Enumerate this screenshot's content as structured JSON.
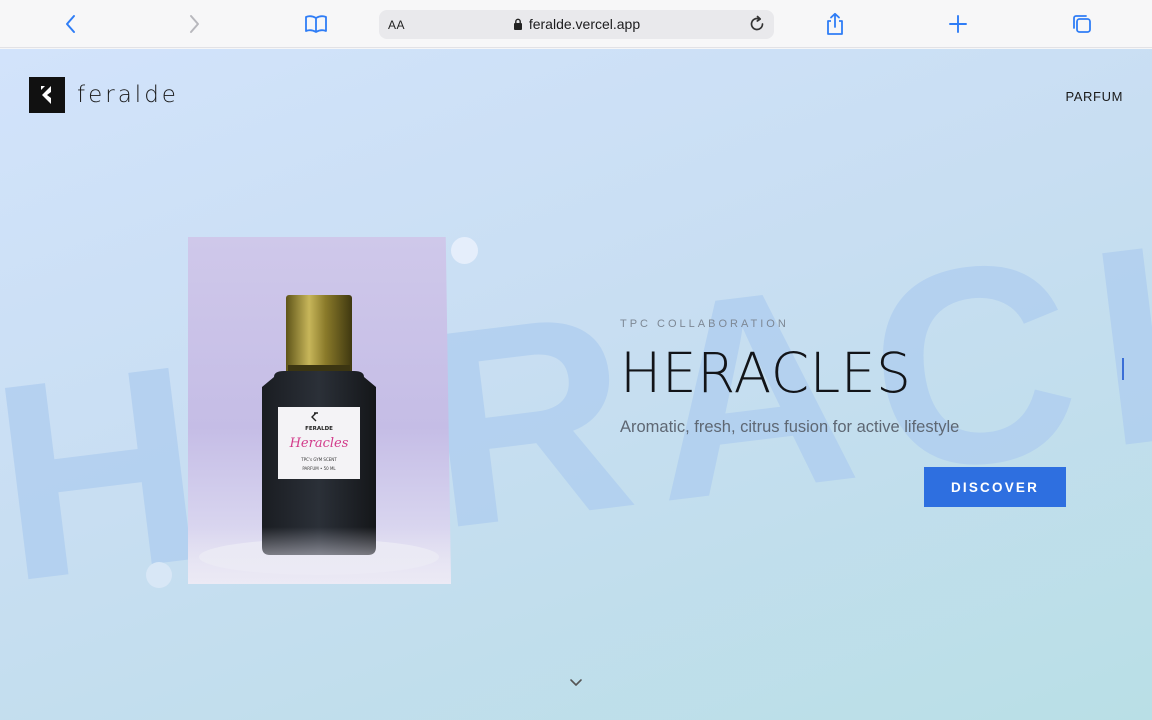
{
  "browser": {
    "url": "feralde.vercel.app",
    "aa_label": "AA",
    "icons": [
      "back-icon",
      "forward-icon",
      "bookmarks-icon",
      "lock-icon",
      "reload-icon",
      "share-icon",
      "new-tab-icon",
      "tabs-icon"
    ]
  },
  "header": {
    "brand": "feralde",
    "nav_link": "PARFUM"
  },
  "hero": {
    "background_word": "HERACLES",
    "eyebrow": "TPC COLLABORATION",
    "title": "HERACLES",
    "tagline": "Aromatic, fresh, citrus fusion for active lifestyle",
    "cta": "DISCOVER",
    "accent_color": "#2e6fe0"
  },
  "bottle_label": {
    "brand": "FERALDE",
    "name": "Heracles",
    "line1": "TPC's GYM SCENT",
    "line2": "PARFUM • 50 ML"
  },
  "scroll_icon": "chevron-down-icon"
}
